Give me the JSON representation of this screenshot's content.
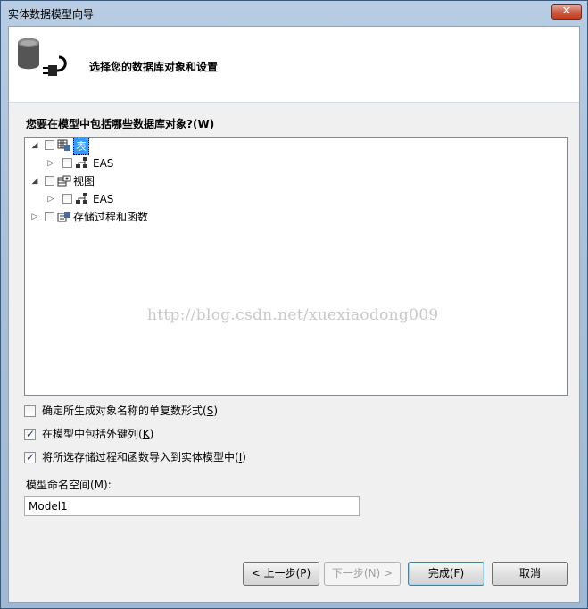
{
  "window": {
    "title": "实体数据模型向导",
    "close_label": "✕"
  },
  "header": {
    "title": "选择您的数据库对象和设置"
  },
  "question": {
    "text": "您要在模型中包括哪些数据库对象?(",
    "accel": "W",
    "end": ")"
  },
  "tree": {
    "tables": {
      "label": "表",
      "child": "EAS"
    },
    "views": {
      "label": "视图",
      "child": "EAS"
    },
    "procs": {
      "label": "存储过程和函数"
    }
  },
  "watermark": "http://blog.csdn.net/xuexiaodong009",
  "options": [
    {
      "label": "确定所生成对象名称的单复数形式(",
      "accel": "S",
      "end": ")",
      "checked": false
    },
    {
      "label": "在模型中包括外键列(",
      "accel": "K",
      "end": ")",
      "checked": true
    },
    {
      "label": "将所选存储过程和函数导入到实体模型中(",
      "accel": "I",
      "end": ")",
      "checked": true
    }
  ],
  "namespace": {
    "label": "模型命名空间(M):",
    "value": "Model1"
  },
  "buttons": {
    "prev": "< 上一步(P)",
    "next": "下一步(N) >",
    "finish": "完成(F)",
    "cancel": "取消"
  }
}
